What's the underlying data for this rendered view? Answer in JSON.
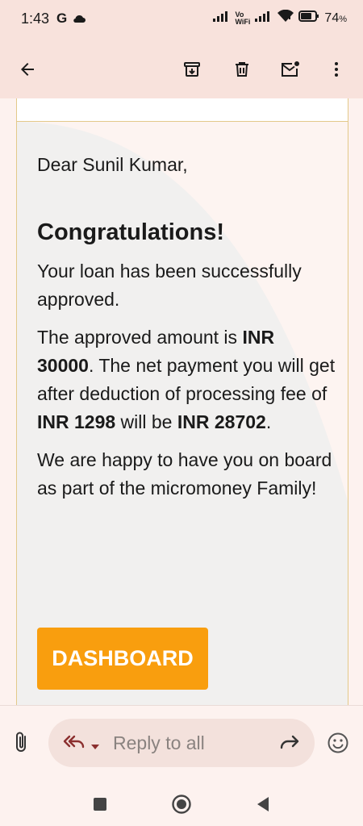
{
  "status_bar": {
    "time": "1:43",
    "g_label": "G",
    "volte_label_top": "Vo",
    "volte_label_bottom": "WiFi",
    "battery_percent": "74",
    "battery_suffix": "%"
  },
  "toolbar": {
    "back_icon": "arrow-left-icon",
    "archive_icon": "archive-icon",
    "delete_icon": "trash-icon",
    "mark_unread_icon": "mail-unread-icon",
    "more_icon": "more-vert-icon"
  },
  "email": {
    "greeting": "Dear Sunil Kumar,",
    "headline": "Congratulations!",
    "para1": "Your loan has been successfully approved.",
    "para2": {
      "t1": "The approved amount is ",
      "b1": "INR 30000",
      "t2": ". The net payment you will get after deduction of processing fee of ",
      "b2": "INR 1298",
      "t3": " will be ",
      "b3": "INR 28702",
      "t4": "."
    },
    "para3": "We are happy to have you on board as part of the micromoney Family!",
    "button_label": "DASHBOARD",
    "button_color": "#f99e0e"
  },
  "reply_bar": {
    "placeholder": "Reply to all"
  },
  "colors": {
    "header_bg": "#f8e2dc",
    "accent_orange": "#f99e0e",
    "reply_icon": "#8b2f2f"
  }
}
